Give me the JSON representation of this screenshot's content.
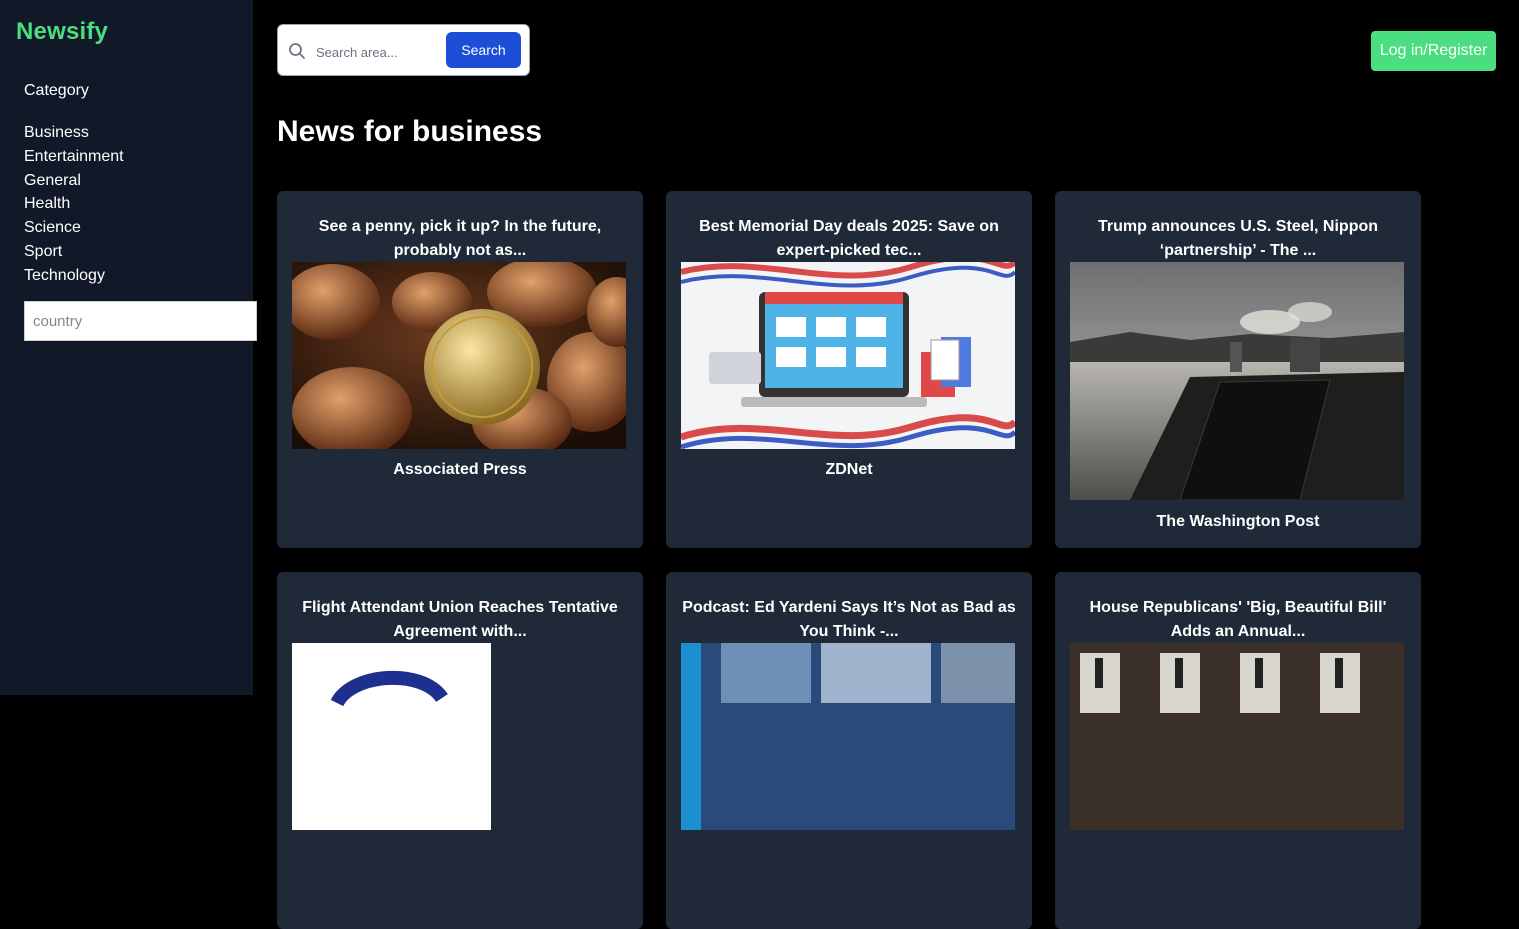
{
  "sidebar": {
    "brand": "Newsify",
    "category_heading": "Category",
    "categories": [
      "Business",
      "Entertainment",
      "General",
      "Health",
      "Science",
      "Sport",
      "Technology"
    ],
    "country_placeholder": "country"
  },
  "header": {
    "search_placeholder": "Search area...",
    "search_button": "Search",
    "login_button": "Log in/Register"
  },
  "main": {
    "title": "News for business",
    "articles": [
      {
        "title": "See a penny, pick it up? In the future, probably not as...",
        "source": "Associated Press",
        "image": "pennies-photo"
      },
      {
        "title": "Best Memorial Day deals 2025: Save on expert-picked tec...",
        "source": "ZDNet",
        "image": "laptop-shopping-illustration"
      },
      {
        "title": "Trump announces U.S. Steel, Nippon ‘partnership’ - The ...",
        "source": "The Washington Post",
        "image": "river-steel-plant-photo"
      },
      {
        "title": "Flight Attendant Union Reaches Tentative Agreement with...",
        "source": "",
        "image": "union-logo"
      },
      {
        "title": "Podcast: Ed Yardeni Says It’s Not as Bad as You Think -...",
        "source": "",
        "image": "podcast-studio-photo"
      },
      {
        "title": "House Republicans' 'Big, Beautiful Bill' Adds an Annual...",
        "source": "",
        "image": "ev-charging-photo"
      }
    ]
  },
  "colors": {
    "brand": "#4ade80",
    "sidebar_bg": "#111827",
    "card_bg": "#1f2937",
    "search_button": "#1d4ed8",
    "login_button": "#4ade80"
  }
}
